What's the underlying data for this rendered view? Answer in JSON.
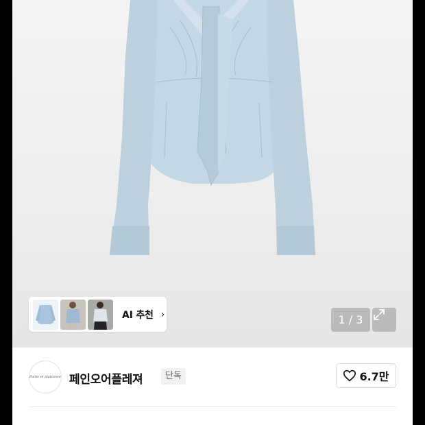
{
  "product_image": {
    "alt_icon": "shirt-photo"
  },
  "ai_recommend": {
    "label": "AI 추천",
    "chevron": "›"
  },
  "pager": {
    "current": "1",
    "separator": "/",
    "total": "3",
    "text": "1 / 3"
  },
  "expand": {
    "icon": "expand-icon"
  },
  "brand": {
    "logo_text": "Paine et plaisance",
    "name": "페인오어플레져",
    "badge": "단독"
  },
  "likes": {
    "icon": "heart-icon",
    "count": "6.7만"
  },
  "colors": {
    "shirt": "#bfd3e1",
    "accent_text": "#111111",
    "pager_bg": "#969696"
  }
}
